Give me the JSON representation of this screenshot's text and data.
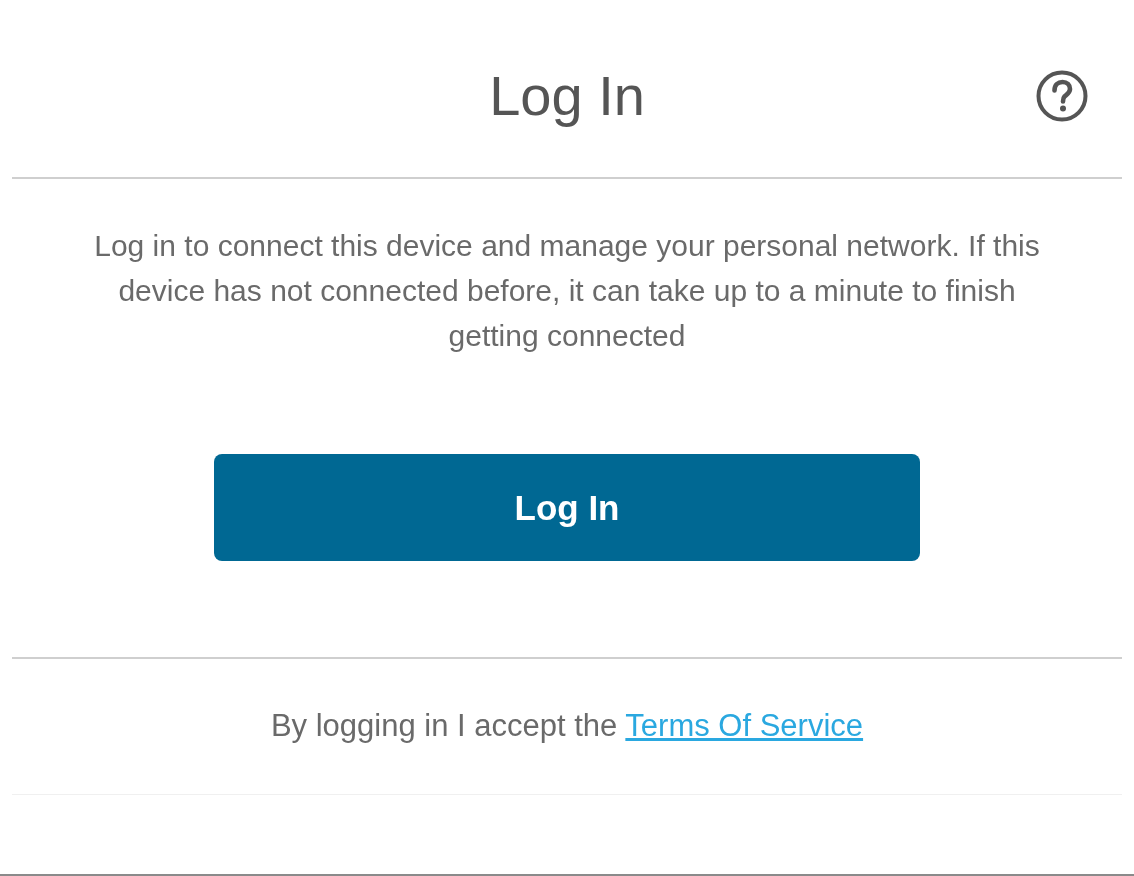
{
  "header": {
    "title": "Log In"
  },
  "message": "Log in to connect this device and manage your personal network. If this device has not connected before, it can take up to a minute to finish getting connected",
  "login_button": {
    "label": "Log In"
  },
  "footer": {
    "text": "By logging in I accept the",
    "link": "Terms Of Service"
  }
}
